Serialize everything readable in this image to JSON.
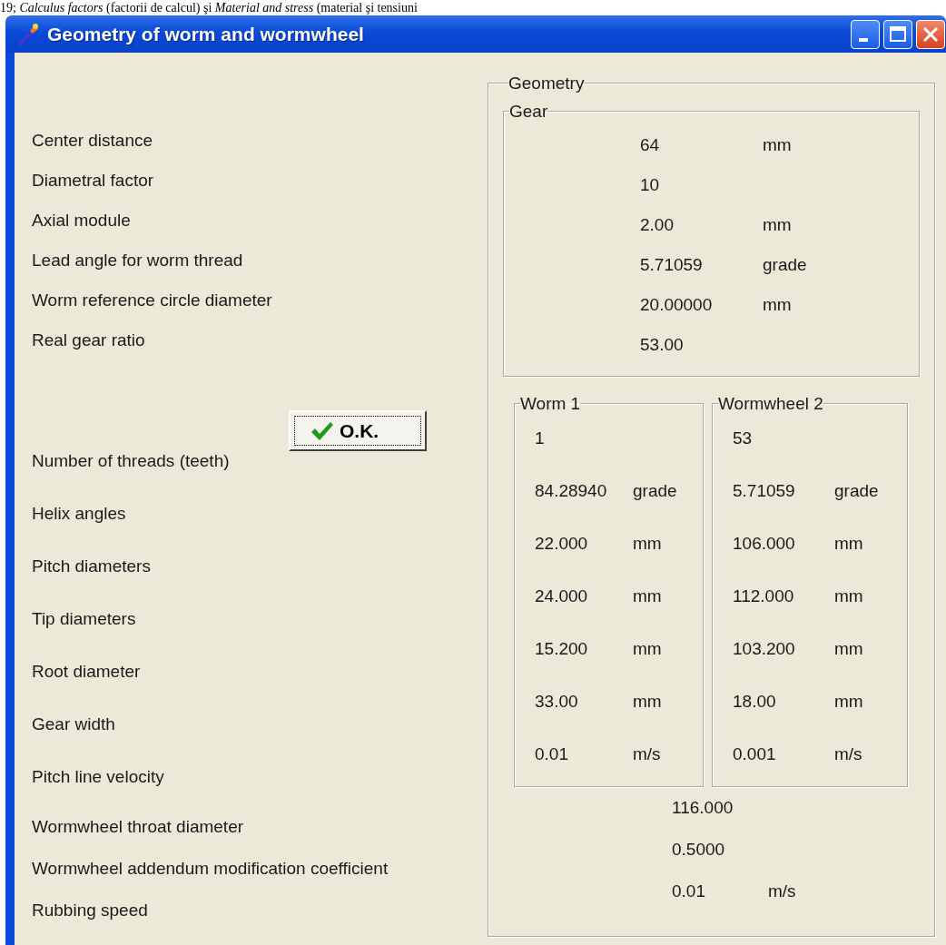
{
  "document_text": "19; *Calculus factors* (factorii de calcul) şi *Material and stress* (material şi tensiuni",
  "window": {
    "title": "Geometry of worm and wormwheel",
    "controls": [
      {
        "kind": "minimize"
      },
      {
        "kind": "maximize"
      },
      {
        "kind": "close"
      }
    ]
  },
  "geometry": {
    "legend": "Geometry",
    "gear_legend": "Gear",
    "worm_legend": "Worm 1",
    "wormwheel_legend": "Wormwheel 2"
  },
  "gear_rows": [
    {
      "label": "Center distance",
      "value": "64",
      "unit": "mm"
    },
    {
      "label": "Diametral factor",
      "value": "10"
    },
    {
      "label": "Axial module",
      "value": "2.00",
      "unit": "mm"
    },
    {
      "label": "Lead angle for worm thread",
      "value": "5.71059",
      "unit": "grade"
    },
    {
      "label": "Worm reference circle diameter",
      "value": "20.00000",
      "unit": "mm"
    },
    {
      "label": "Real gear ratio",
      "value": "53.00"
    }
  ],
  "ok_button": "O.K.",
  "member_rows": [
    {
      "label": "Number of threads (teeth)",
      "worm": {
        "value": "1"
      },
      "wormwheel": {
        "value": "53"
      }
    },
    {
      "label": "Helix angles",
      "worm": {
        "value": "84.28940",
        "unit": "grade"
      },
      "wormwheel": {
        "value": "5.71059",
        "unit": "grade"
      }
    },
    {
      "label": "Pitch diameters",
      "worm": {
        "value": "22.000",
        "unit": "mm"
      },
      "wormwheel": {
        "value": "106.000",
        "unit": "mm"
      }
    },
    {
      "label": "Tip diameters",
      "worm": {
        "value": "24.000",
        "unit": "mm"
      },
      "wormwheel": {
        "value": "112.000",
        "unit": "mm"
      }
    },
    {
      "label": "Root diameter",
      "worm": {
        "value": "15.200",
        "unit": "mm"
      },
      "wormwheel": {
        "value": "103.200",
        "unit": "mm"
      }
    },
    {
      "label": "Gear width",
      "worm": {
        "value": "33.00",
        "unit": "mm"
      },
      "wormwheel": {
        "value": "18.00",
        "unit": "mm"
      }
    },
    {
      "label": "Pitch line velocity",
      "worm": {
        "value": "0.01",
        "unit": "m/s"
      },
      "wormwheel": {
        "value": "0.001",
        "unit": "m/s"
      }
    }
  ],
  "extra_rows": [
    {
      "label": "Wormwheel throat diameter",
      "value": "116.000"
    },
    {
      "label": "Wormwheel addendum modification coefficient",
      "value": "0.5000"
    },
    {
      "label": "Rubbing speed",
      "value": "0.01",
      "unit": "m/s"
    }
  ]
}
